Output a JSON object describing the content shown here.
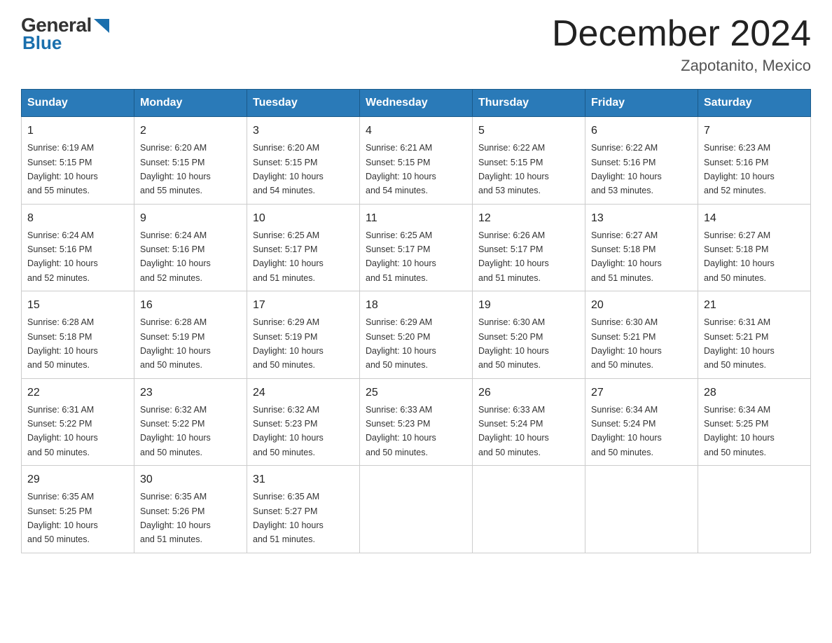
{
  "header": {
    "logo_general": "General",
    "logo_blue": "Blue",
    "calendar_title": "December 2024",
    "calendar_subtitle": "Zapotanito, Mexico"
  },
  "weekdays": [
    "Sunday",
    "Monday",
    "Tuesday",
    "Wednesday",
    "Thursday",
    "Friday",
    "Saturday"
  ],
  "weeks": [
    [
      {
        "day": "1",
        "sunrise": "6:19 AM",
        "sunset": "5:15 PM",
        "daylight": "10 hours and 55 minutes."
      },
      {
        "day": "2",
        "sunrise": "6:20 AM",
        "sunset": "5:15 PM",
        "daylight": "10 hours and 55 minutes."
      },
      {
        "day": "3",
        "sunrise": "6:20 AM",
        "sunset": "5:15 PM",
        "daylight": "10 hours and 54 minutes."
      },
      {
        "day": "4",
        "sunrise": "6:21 AM",
        "sunset": "5:15 PM",
        "daylight": "10 hours and 54 minutes."
      },
      {
        "day": "5",
        "sunrise": "6:22 AM",
        "sunset": "5:15 PM",
        "daylight": "10 hours and 53 minutes."
      },
      {
        "day": "6",
        "sunrise": "6:22 AM",
        "sunset": "5:16 PM",
        "daylight": "10 hours and 53 minutes."
      },
      {
        "day": "7",
        "sunrise": "6:23 AM",
        "sunset": "5:16 PM",
        "daylight": "10 hours and 52 minutes."
      }
    ],
    [
      {
        "day": "8",
        "sunrise": "6:24 AM",
        "sunset": "5:16 PM",
        "daylight": "10 hours and 52 minutes."
      },
      {
        "day": "9",
        "sunrise": "6:24 AM",
        "sunset": "5:16 PM",
        "daylight": "10 hours and 52 minutes."
      },
      {
        "day": "10",
        "sunrise": "6:25 AM",
        "sunset": "5:17 PM",
        "daylight": "10 hours and 51 minutes."
      },
      {
        "day": "11",
        "sunrise": "6:25 AM",
        "sunset": "5:17 PM",
        "daylight": "10 hours and 51 minutes."
      },
      {
        "day": "12",
        "sunrise": "6:26 AM",
        "sunset": "5:17 PM",
        "daylight": "10 hours and 51 minutes."
      },
      {
        "day": "13",
        "sunrise": "6:27 AM",
        "sunset": "5:18 PM",
        "daylight": "10 hours and 51 minutes."
      },
      {
        "day": "14",
        "sunrise": "6:27 AM",
        "sunset": "5:18 PM",
        "daylight": "10 hours and 50 minutes."
      }
    ],
    [
      {
        "day": "15",
        "sunrise": "6:28 AM",
        "sunset": "5:18 PM",
        "daylight": "10 hours and 50 minutes."
      },
      {
        "day": "16",
        "sunrise": "6:28 AM",
        "sunset": "5:19 PM",
        "daylight": "10 hours and 50 minutes."
      },
      {
        "day": "17",
        "sunrise": "6:29 AM",
        "sunset": "5:19 PM",
        "daylight": "10 hours and 50 minutes."
      },
      {
        "day": "18",
        "sunrise": "6:29 AM",
        "sunset": "5:20 PM",
        "daylight": "10 hours and 50 minutes."
      },
      {
        "day": "19",
        "sunrise": "6:30 AM",
        "sunset": "5:20 PM",
        "daylight": "10 hours and 50 minutes."
      },
      {
        "day": "20",
        "sunrise": "6:30 AM",
        "sunset": "5:21 PM",
        "daylight": "10 hours and 50 minutes."
      },
      {
        "day": "21",
        "sunrise": "6:31 AM",
        "sunset": "5:21 PM",
        "daylight": "10 hours and 50 minutes."
      }
    ],
    [
      {
        "day": "22",
        "sunrise": "6:31 AM",
        "sunset": "5:22 PM",
        "daylight": "10 hours and 50 minutes."
      },
      {
        "day": "23",
        "sunrise": "6:32 AM",
        "sunset": "5:22 PM",
        "daylight": "10 hours and 50 minutes."
      },
      {
        "day": "24",
        "sunrise": "6:32 AM",
        "sunset": "5:23 PM",
        "daylight": "10 hours and 50 minutes."
      },
      {
        "day": "25",
        "sunrise": "6:33 AM",
        "sunset": "5:23 PM",
        "daylight": "10 hours and 50 minutes."
      },
      {
        "day": "26",
        "sunrise": "6:33 AM",
        "sunset": "5:24 PM",
        "daylight": "10 hours and 50 minutes."
      },
      {
        "day": "27",
        "sunrise": "6:34 AM",
        "sunset": "5:24 PM",
        "daylight": "10 hours and 50 minutes."
      },
      {
        "day": "28",
        "sunrise": "6:34 AM",
        "sunset": "5:25 PM",
        "daylight": "10 hours and 50 minutes."
      }
    ],
    [
      {
        "day": "29",
        "sunrise": "6:35 AM",
        "sunset": "5:25 PM",
        "daylight": "10 hours and 50 minutes."
      },
      {
        "day": "30",
        "sunrise": "6:35 AM",
        "sunset": "5:26 PM",
        "daylight": "10 hours and 51 minutes."
      },
      {
        "day": "31",
        "sunrise": "6:35 AM",
        "sunset": "5:27 PM",
        "daylight": "10 hours and 51 minutes."
      },
      null,
      null,
      null,
      null
    ]
  ],
  "labels": {
    "sunrise": "Sunrise:",
    "sunset": "Sunset:",
    "daylight": "Daylight:"
  }
}
